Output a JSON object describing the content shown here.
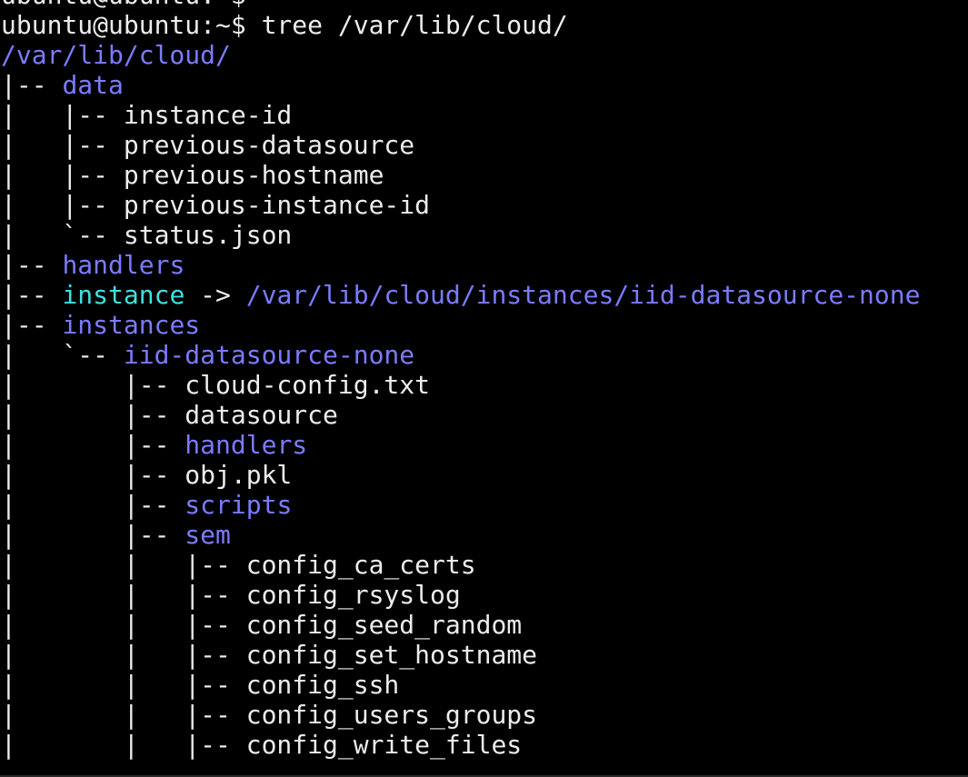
{
  "terminal": {
    "colors": {
      "background": "#000000",
      "text": "#ececec",
      "directory": "#7b7bff",
      "symlink": "#3fe0e0"
    },
    "lines": [
      {
        "name": "previous-prompt-line",
        "segments": [
          {
            "text": "ubuntu@ubuntu:~$",
            "style": "plain"
          }
        ]
      },
      {
        "name": "command-line",
        "segments": [
          {
            "text": "ubuntu@ubuntu:~$ tree /var/lib/cloud/",
            "style": "plain"
          }
        ]
      },
      {
        "name": "root-dir",
        "segments": [
          {
            "text": "/var/lib/cloud/",
            "style": "dir"
          }
        ]
      },
      {
        "name": "entry-data",
        "segments": [
          {
            "text": "|-- ",
            "style": "plain"
          },
          {
            "text": "data",
            "style": "dir"
          }
        ]
      },
      {
        "name": "entry-instance-id",
        "segments": [
          {
            "text": "|   |-- instance-id",
            "style": "plain"
          }
        ]
      },
      {
        "name": "entry-previous-datasource",
        "segments": [
          {
            "text": "|   |-- previous-datasource",
            "style": "plain"
          }
        ]
      },
      {
        "name": "entry-previous-hostname",
        "segments": [
          {
            "text": "|   |-- previous-hostname",
            "style": "plain"
          }
        ]
      },
      {
        "name": "entry-previous-instance-id",
        "segments": [
          {
            "text": "|   |-- previous-instance-id",
            "style": "plain"
          }
        ]
      },
      {
        "name": "entry-status-json",
        "segments": [
          {
            "text": "|   `-- status.json",
            "style": "plain"
          }
        ]
      },
      {
        "name": "entry-handlers",
        "segments": [
          {
            "text": "|-- ",
            "style": "plain"
          },
          {
            "text": "handlers",
            "style": "dir"
          }
        ]
      },
      {
        "name": "entry-instance-symlink",
        "segments": [
          {
            "text": "|-- ",
            "style": "plain"
          },
          {
            "text": "instance",
            "style": "link"
          },
          {
            "text": " -> ",
            "style": "arrow"
          },
          {
            "text": "/var/lib/cloud/instances/iid-datasource-none",
            "style": "target"
          }
        ]
      },
      {
        "name": "entry-instances",
        "segments": [
          {
            "text": "|-- ",
            "style": "plain"
          },
          {
            "text": "instances",
            "style": "dir"
          }
        ]
      },
      {
        "name": "entry-iid-datasource-none",
        "segments": [
          {
            "text": "|   `-- ",
            "style": "plain"
          },
          {
            "text": "iid-datasource-none",
            "style": "dir"
          }
        ]
      },
      {
        "name": "entry-cloud-config-txt",
        "segments": [
          {
            "text": "|       |-- cloud-config.txt",
            "style": "plain"
          }
        ]
      },
      {
        "name": "entry-datasource",
        "segments": [
          {
            "text": "|       |-- datasource",
            "style": "plain"
          }
        ]
      },
      {
        "name": "entry-sub-handlers",
        "segments": [
          {
            "text": "|       |-- ",
            "style": "plain"
          },
          {
            "text": "handlers",
            "style": "dir"
          }
        ]
      },
      {
        "name": "entry-obj-pkl",
        "segments": [
          {
            "text": "|       |-- obj.pkl",
            "style": "plain"
          }
        ]
      },
      {
        "name": "entry-scripts",
        "segments": [
          {
            "text": "|       |-- ",
            "style": "plain"
          },
          {
            "text": "scripts",
            "style": "dir"
          }
        ]
      },
      {
        "name": "entry-sem",
        "segments": [
          {
            "text": "|       |-- ",
            "style": "plain"
          },
          {
            "text": "sem",
            "style": "dir"
          }
        ]
      },
      {
        "name": "entry-config-ca-certs",
        "segments": [
          {
            "text": "|       |   |-- config_ca_certs",
            "style": "plain"
          }
        ]
      },
      {
        "name": "entry-config-rsyslog",
        "segments": [
          {
            "text": "|       |   |-- config_rsyslog",
            "style": "plain"
          }
        ]
      },
      {
        "name": "entry-config-seed-random",
        "segments": [
          {
            "text": "|       |   |-- config_seed_random",
            "style": "plain"
          }
        ]
      },
      {
        "name": "entry-config-set-hostname",
        "segments": [
          {
            "text": "|       |   |-- config_set_hostname",
            "style": "plain"
          }
        ]
      },
      {
        "name": "entry-config-ssh",
        "segments": [
          {
            "text": "|       |   |-- config_ssh",
            "style": "plain"
          }
        ]
      },
      {
        "name": "entry-config-users-groups",
        "segments": [
          {
            "text": "|       |   |-- config_users_groups",
            "style": "plain"
          }
        ]
      },
      {
        "name": "entry-config-write-files",
        "segments": [
          {
            "text": "|       |   |-- config_write_files",
            "style": "plain"
          }
        ]
      }
    ]
  }
}
